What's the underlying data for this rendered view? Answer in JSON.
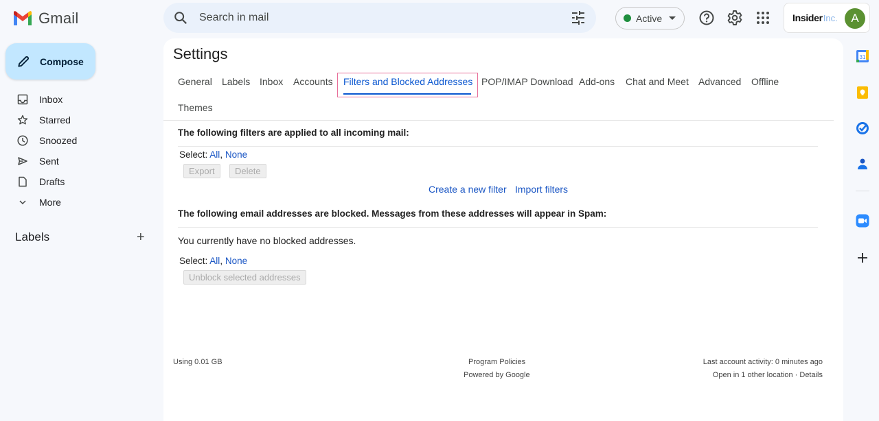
{
  "header": {
    "app_name": "Gmail",
    "search_placeholder": "Search in mail",
    "status": "Active",
    "account_brand_bold": "Insider",
    "account_brand_light": "Inc.",
    "avatar_initial": "A"
  },
  "sidebar": {
    "compose_label": "Compose",
    "items": [
      {
        "label": "Inbox",
        "icon": "inbox-icon"
      },
      {
        "label": "Starred",
        "icon": "star-icon"
      },
      {
        "label": "Snoozed",
        "icon": "clock-icon"
      },
      {
        "label": "Sent",
        "icon": "send-icon"
      },
      {
        "label": "Drafts",
        "icon": "draft-icon"
      },
      {
        "label": "More",
        "icon": "chevron-down-icon"
      }
    ],
    "labels_heading": "Labels",
    "labels_add": "+"
  },
  "settings": {
    "title": "Settings",
    "tabs": [
      {
        "label": "General"
      },
      {
        "label": "Labels"
      },
      {
        "label": "Inbox"
      },
      {
        "label": "Accounts"
      },
      {
        "label": "Filters and Blocked Addresses",
        "selected": true
      },
      {
        "label": "POP/IMAP Download"
      },
      {
        "label": "Add-ons"
      },
      {
        "label": "Chat and Meet"
      },
      {
        "label": "Advanced"
      },
      {
        "label": "Offline"
      },
      {
        "label": "Themes"
      }
    ],
    "filters": {
      "heading": "The following filters are applied to all incoming mail:",
      "select_label": "Select:",
      "select_all": "All",
      "select_sep": ",",
      "select_none": "None",
      "export_label": "Export",
      "delete_label": "Delete",
      "create_filter": "Create a new filter",
      "import_filters": "Import filters"
    },
    "blocked": {
      "heading": "The following email addresses are blocked. Messages from these addresses will appear in Spam:",
      "empty_message": "You currently have no blocked addresses.",
      "select_label": "Select:",
      "select_all": "All",
      "select_sep": ",",
      "select_none": "None",
      "unblock_label": "Unblock selected addresses"
    }
  },
  "footer": {
    "storage": "Using 0.01 GB",
    "program_policies": "Program Policies",
    "powered_by": "Powered by Google",
    "last_activity": "Last account activity: 0 minutes ago",
    "open_locations": "Open in 1 other location",
    "dot_sep": " · ",
    "details": "Details"
  },
  "colors": {
    "accent": "#0b57d0",
    "compose_bg": "#c2e7ff",
    "active_dot": "#1e8e3e",
    "avatar_bg": "#5b9131",
    "highlight_box": "#e8709a"
  }
}
